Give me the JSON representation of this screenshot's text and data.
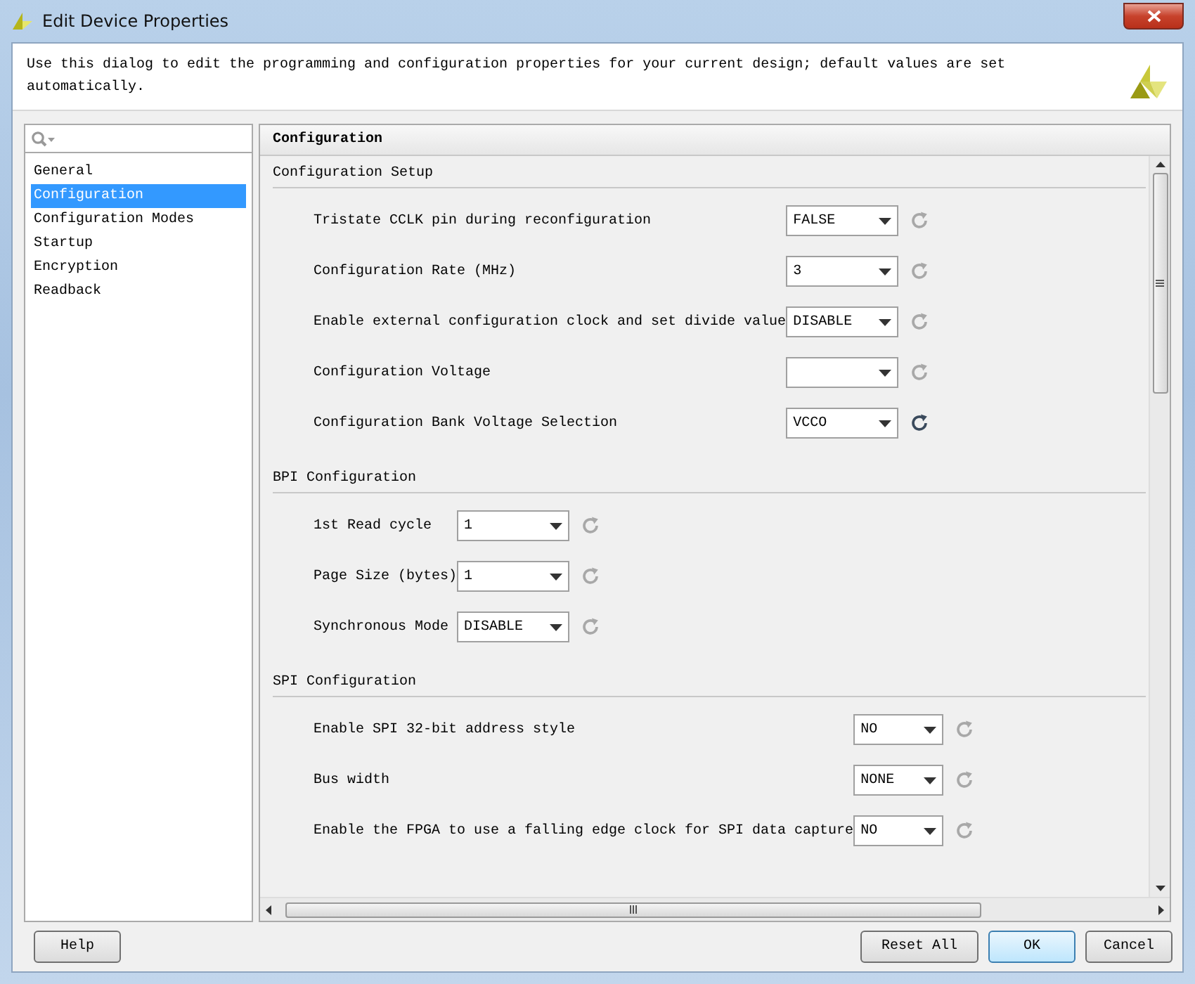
{
  "window": {
    "title": "Edit Device Properties"
  },
  "description": "Use this dialog to edit the programming and configuration properties for your current design; default values are set automatically.",
  "sidebar": {
    "items": [
      {
        "label": "General",
        "selected": false
      },
      {
        "label": "Configuration",
        "selected": true
      },
      {
        "label": "Configuration Modes",
        "selected": false
      },
      {
        "label": "Startup",
        "selected": false
      },
      {
        "label": "Encryption",
        "selected": false
      },
      {
        "label": "Readback",
        "selected": false
      }
    ]
  },
  "panel": {
    "title": "Configuration",
    "sections": [
      {
        "title": "Configuration Setup",
        "rows": [
          {
            "label": "Tristate CCLK pin during reconfiguration",
            "value": "FALSE",
            "reset_enabled": false
          },
          {
            "label": "Configuration Rate (MHz)",
            "value": "3",
            "reset_enabled": false
          },
          {
            "label": "Enable external configuration clock and set divide value",
            "value": "DISABLE",
            "reset_enabled": false
          },
          {
            "label": "Configuration Voltage",
            "reset_enabled": false
          },
          {
            "label": "Configuration Bank Voltage Selection",
            "value": "VCCO",
            "reset_enabled": true
          }
        ]
      },
      {
        "title": "BPI Configuration",
        "rows": [
          {
            "label": "1st Read cycle",
            "value": "1",
            "reset_enabled": false
          },
          {
            "label": "Page Size (bytes)",
            "value": "1",
            "reset_enabled": false
          },
          {
            "label": "Synchronous Mode",
            "value": "DISABLE",
            "reset_enabled": false
          }
        ]
      },
      {
        "title": "SPI Configuration",
        "rows": [
          {
            "label": "Enable SPI 32-bit address style",
            "value": "NO",
            "reset_enabled": false
          },
          {
            "label": "Bus width",
            "value": "NONE",
            "reset_enabled": false
          },
          {
            "label": "Enable the FPGA to use a falling edge clock for SPI data capture",
            "value": "NO",
            "reset_enabled": false
          }
        ]
      }
    ]
  },
  "buttons": [
    {
      "label": "Help",
      "default": false
    },
    {
      "label": "Reset All",
      "default": false
    },
    {
      "label": "OK",
      "default": true
    },
    {
      "label": "Cancel",
      "default": false
    }
  ]
}
